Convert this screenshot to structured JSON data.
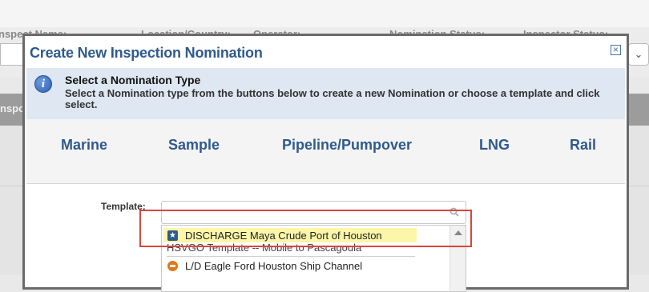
{
  "background": {
    "filters": [
      "nspect Name:",
      "Location/Country:",
      "Operator:",
      "Nomination Status:",
      "Inspector Status:"
    ],
    "band_text": "nspo"
  },
  "dialog": {
    "title": "Create New Inspection Nomination",
    "close_glyph": "×",
    "info": {
      "heading": "Select a Nomination Type",
      "description": "Select a Nomination type from the buttons below to create a new Nomination or choose a template and click select."
    },
    "types": [
      "Marine",
      "Sample",
      "Pipeline/Pumpover",
      "LNG",
      "Rail"
    ],
    "template": {
      "label": "Template:",
      "value": "",
      "items": [
        {
          "label": "DISCHARGE Maya Crude Port of Houston",
          "icon": "star-icon"
        },
        {
          "label": "HSVGO Template -- Mobile to Pascagoula",
          "icon": ""
        },
        {
          "label": "L/D Eagle Ford Houston Ship Channel",
          "icon": "pipeline-icon"
        }
      ]
    }
  },
  "colors": {
    "accent": "#2f5a8d",
    "highlight": "#fbf6a8",
    "annotation": "#d9463a"
  }
}
